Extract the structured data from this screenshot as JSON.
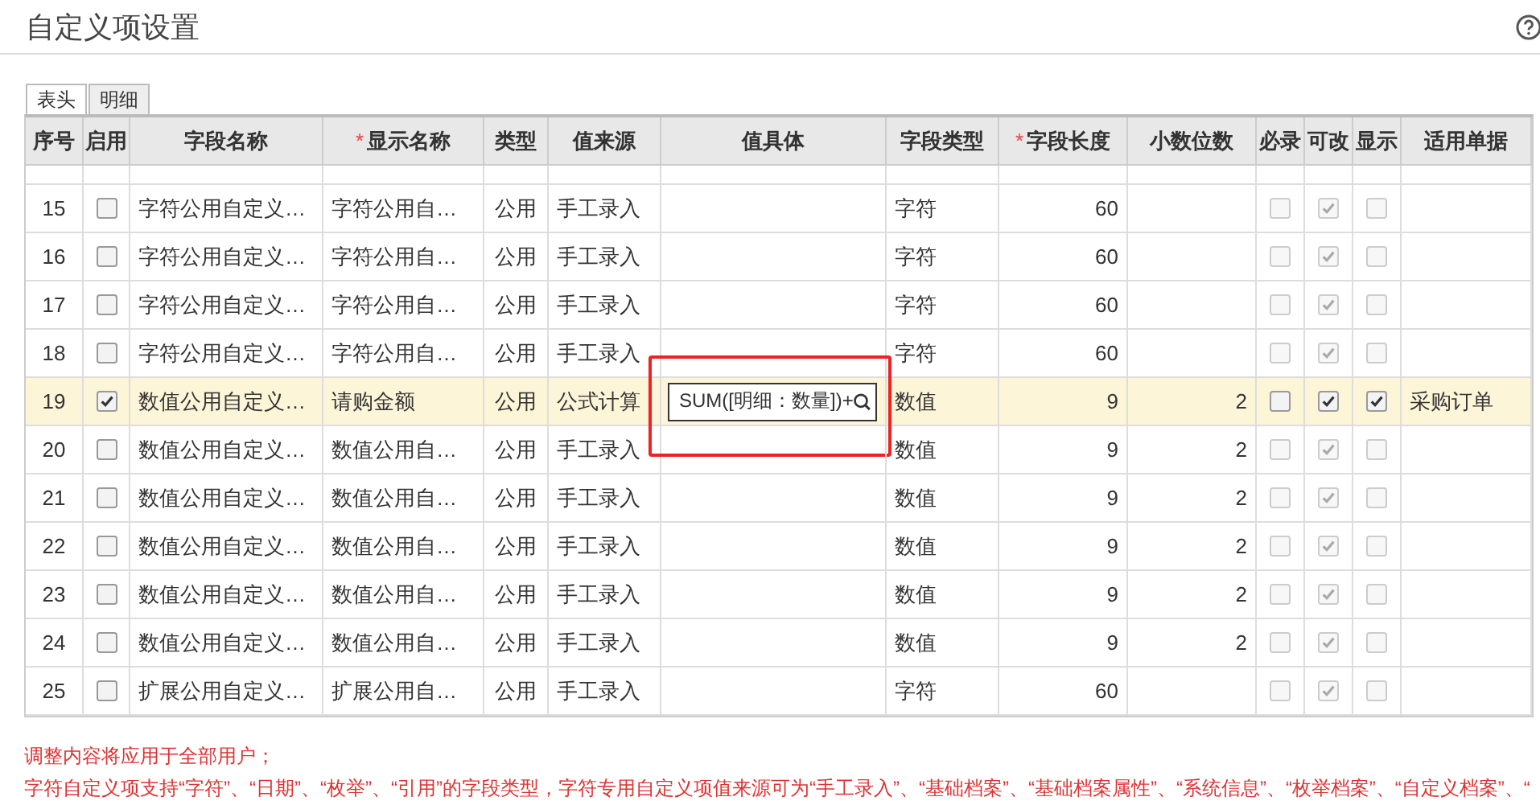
{
  "window": {
    "title": "自定义项设置"
  },
  "tabs": [
    {
      "label": "表头",
      "selected": true
    },
    {
      "label": "明细",
      "selected": false
    }
  ],
  "table": {
    "columns": [
      {
        "label": "序号"
      },
      {
        "label": "启用"
      },
      {
        "label": "字段名称"
      },
      {
        "label": "显示名称",
        "marker": "*"
      },
      {
        "label": "类型"
      },
      {
        "label": "值来源"
      },
      {
        "label": "值具体"
      },
      {
        "label": "字段类型"
      },
      {
        "label": "字段长度",
        "marker": "*"
      },
      {
        "label": "小数位数"
      },
      {
        "label": "必录"
      },
      {
        "label": "可改"
      },
      {
        "label": "显示"
      },
      {
        "label": "适用单据"
      }
    ],
    "rows": [
      {
        "no": "15",
        "enabled": false,
        "field_name": "字符公用自定义…",
        "display_name": "字符公用自…",
        "type": "公用",
        "source": "手工录入",
        "field_type": "字符",
        "length": "60",
        "selected": false,
        "options_disabled": true,
        "required": false,
        "editable": true,
        "shown": false
      },
      {
        "no": "16",
        "enabled": false,
        "field_name": "字符公用自定义…",
        "display_name": "字符公用自…",
        "type": "公用",
        "source": "手工录入",
        "field_type": "字符",
        "length": "60",
        "selected": false,
        "options_disabled": true,
        "required": false,
        "editable": true,
        "shown": false
      },
      {
        "no": "17",
        "enabled": false,
        "field_name": "字符公用自定义…",
        "display_name": "字符公用自…",
        "type": "公用",
        "source": "手工录入",
        "field_type": "字符",
        "length": "60",
        "selected": false,
        "options_disabled": true,
        "required": false,
        "editable": true,
        "shown": false
      },
      {
        "no": "18",
        "enabled": false,
        "field_name": "字符公用自定义…",
        "display_name": "字符公用自…",
        "type": "公用",
        "source": "手工录入",
        "field_type": "字符",
        "length": "60",
        "selected": false,
        "options_disabled": true,
        "required": false,
        "editable": true,
        "shown": false
      },
      {
        "no": "19",
        "enabled": true,
        "field_name": "数值公用自定义…",
        "display_name": "请购金额",
        "type": "公用",
        "source": "公式计算",
        "value": "SUM([明细：数量])+",
        "field_type": "数值",
        "length": "9",
        "decimals": "2",
        "selected": true,
        "options_disabled": false,
        "required": false,
        "editable": true,
        "shown": true,
        "documents": "采购订单"
      },
      {
        "no": "20",
        "enabled": false,
        "field_name": "数值公用自定义…",
        "display_name": "数值公用自…",
        "type": "公用",
        "source": "手工录入",
        "field_type": "数值",
        "length": "9",
        "decimals": "2",
        "selected": false,
        "options_disabled": true,
        "required": false,
        "editable": true,
        "shown": false
      },
      {
        "no": "21",
        "enabled": false,
        "field_name": "数值公用自定义…",
        "display_name": "数值公用自…",
        "type": "公用",
        "source": "手工录入",
        "field_type": "数值",
        "length": "9",
        "decimals": "2",
        "selected": false,
        "options_disabled": true,
        "required": false,
        "editable": true,
        "shown": false
      },
      {
        "no": "22",
        "enabled": false,
        "field_name": "数值公用自定义…",
        "display_name": "数值公用自…",
        "type": "公用",
        "source": "手工录入",
        "field_type": "数值",
        "length": "9",
        "decimals": "2",
        "selected": false,
        "options_disabled": true,
        "required": false,
        "editable": true,
        "shown": false
      },
      {
        "no": "23",
        "enabled": false,
        "field_name": "数值公用自定义…",
        "display_name": "数值公用自…",
        "type": "公用",
        "source": "手工录入",
        "field_type": "数值",
        "length": "9",
        "decimals": "2",
        "selected": false,
        "options_disabled": true,
        "required": false,
        "editable": true,
        "shown": false
      },
      {
        "no": "24",
        "enabled": false,
        "field_name": "数值公用自定义…",
        "display_name": "数值公用自…",
        "type": "公用",
        "source": "手工录入",
        "field_type": "数值",
        "length": "9",
        "decimals": "2",
        "selected": false,
        "options_disabled": true,
        "required": false,
        "editable": true,
        "shown": false
      },
      {
        "no": "25",
        "enabled": false,
        "field_name": "扩展公用自定义…",
        "display_name": "扩展公用自…",
        "type": "公用",
        "source": "手工录入",
        "field_type": "字符",
        "length": "60",
        "selected": false,
        "options_disabled": true,
        "required": false,
        "editable": true,
        "shown": false
      }
    ]
  },
  "notes": [
    "调整内容将应用于全部用户；",
    "字符自定义项支持“字符”、“日期”、“枚举”、“引用”的字段类型，字符专用自定义项值来源可为“手工录入”、“基础档案”、“基础档案属性”、“系统信息”、“枚举档案”、“自定义档案”、“"
  ]
}
